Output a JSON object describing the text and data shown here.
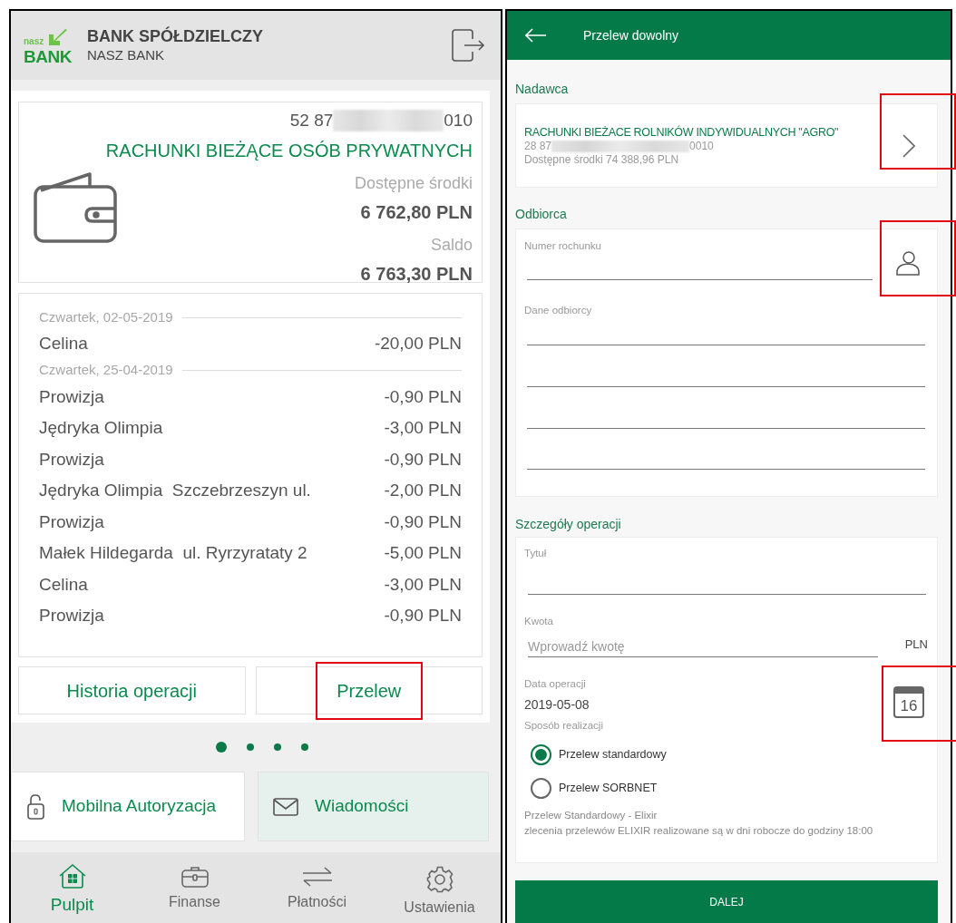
{
  "left_screen": {
    "header": {
      "logo_small": "nasz",
      "logo_large": "BANK",
      "bank_name": "BANK SPÓŁDZIELCZY",
      "bank_subname": "NASZ BANK"
    },
    "account": {
      "number_start": "52 87",
      "number_end": "010",
      "name": "RACHUNKI BIEŻĄCE OSÓB PRYWATNYCH",
      "available_label": "Dostępne środki",
      "available": "6 762,80 PLN",
      "balance_label": "Saldo",
      "balance": "6 763,30 PLN"
    },
    "history": [
      {
        "kind": "date",
        "text": "Czwartek, 02-05-2019"
      },
      {
        "kind": "transaction",
        "title": "Celina",
        "amount": "-20,00 PLN"
      },
      {
        "kind": "date",
        "text": "Czwartek, 25-04-2019"
      },
      {
        "kind": "transaction",
        "title": "Prowizja",
        "amount": "-0,90 PLN"
      },
      {
        "kind": "transaction",
        "title": "Jędryka Olimpia",
        "amount": "-3,00 PLN"
      },
      {
        "kind": "transaction",
        "title": "Prowizja",
        "amount": "-0,90 PLN"
      },
      {
        "kind": "transaction",
        "title": "Jędryka Olimpia  Szczebrzeszyn ul.",
        "amount": "-2,00 PLN"
      },
      {
        "kind": "transaction",
        "title": "Prowizja",
        "amount": "-0,90 PLN"
      },
      {
        "kind": "transaction",
        "title": "Małek Hildegarda  ul. Ryrzyrataty 2",
        "amount": "-5,00 PLN"
      },
      {
        "kind": "transaction",
        "title": "Celina",
        "amount": "-3,00 PLN"
      },
      {
        "kind": "transaction",
        "title": "Prowizja",
        "amount": "-0,90 PLN"
      }
    ],
    "actions": [
      {
        "label": "Historia operacji",
        "highlighted": false
      },
      {
        "label": "Przelew",
        "highlighted": true
      }
    ],
    "pager": [
      {
        "selected": true
      },
      {
        "selected": false
      },
      {
        "selected": false
      },
      {
        "selected": false
      }
    ],
    "tiles": [
      {
        "kind": "lock",
        "label": "Mobilna Autoryzacja",
        "selected": false
      },
      {
        "kind": "mail",
        "label": "Wiadomości",
        "selected": true
      }
    ],
    "nav": [
      {
        "kind": "home",
        "label": "Pulpit",
        "selected": true
      },
      {
        "kind": "briefcase",
        "label": "Finanse",
        "selected": false
      },
      {
        "kind": "arrows",
        "label": "Płatności",
        "selected": false
      },
      {
        "kind": "gear",
        "label": "Ustawienia",
        "selected": false
      }
    ]
  },
  "right_screen": {
    "title": "Przelew dowolny",
    "sender": {
      "heading": "Nadawca",
      "account_name": "RACHUNKI BIEŻACE ROLNIKÓW INDYWIDUALNYCH \"AGRO\"",
      "number_start": "28 87",
      "number_end": "0010",
      "funds": "Dostępne środki 74 388,96 PLN",
      "highlighted": true
    },
    "recipient": {
      "heading": "Odbiorca",
      "account_label": "Numer rochunku",
      "contacts_highlighted": true,
      "details_label": "Dane odbiorcy"
    },
    "details": {
      "heading": "Szczegóły operacji",
      "title_label": "Tytuł",
      "amount_label": "Kwota",
      "amount_placeholder": "Wprowadź kwotę",
      "currency": "PLN",
      "date_label": "Data operacji",
      "date": "2019-05-08",
      "calendar_day": "16",
      "calendar_highlighted": true,
      "method_label": "Sposób realizacji",
      "methods": [
        {
          "label": "Przelew standardowy",
          "selected": true
        },
        {
          "label": "Przelew SORBNET",
          "selected": false
        }
      ],
      "note_title": "Przelew Standardowy - Elixir",
      "note": "zlecenia przelewów ELIXIR realizowane są w dni robocze do godziny 18:00"
    },
    "next_button": "DALEJ"
  }
}
